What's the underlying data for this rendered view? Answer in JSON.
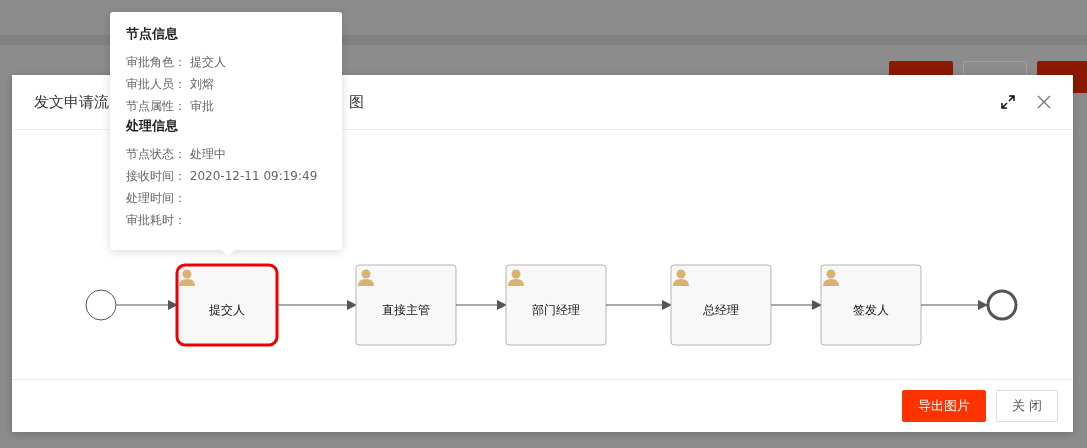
{
  "modal": {
    "title_start": "发文申请流",
    "title_end": "图"
  },
  "tooltip": {
    "sections": [
      {
        "title": "节点信息",
        "rows": [
          {
            "label": "审批角色：",
            "value": "提交人"
          },
          {
            "label": "审批人员：",
            "value": "刘熔"
          },
          {
            "label": "节点属性：",
            "value": "审批"
          }
        ]
      },
      {
        "title": "处理信息",
        "rows": [
          {
            "label": "节点状态：",
            "value": "处理中"
          },
          {
            "label": "接收时间：",
            "value": "2020-12-11 09:19:49"
          },
          {
            "label": "处理时间："
          },
          {
            "label": "审批耗时："
          }
        ]
      }
    ]
  },
  "nodes": [
    {
      "label": "提交人",
      "current": true
    },
    {
      "label": "直接主管",
      "current": false
    },
    {
      "label": "部门经理",
      "current": false
    },
    {
      "label": "总经理",
      "current": false
    },
    {
      "label": "签发人",
      "current": false
    }
  ],
  "buttons": [
    {
      "label": "导出图片",
      "kind": "primary"
    },
    {
      "label": "关 闭",
      "kind": "default"
    }
  ]
}
